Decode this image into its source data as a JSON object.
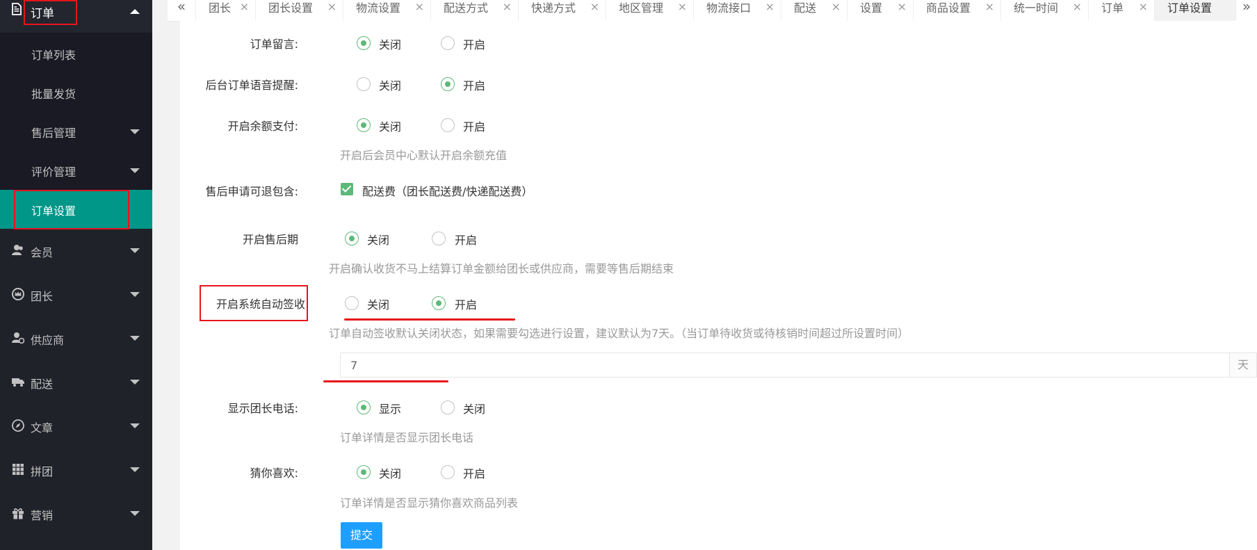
{
  "sidebar": {
    "top": {
      "label": "订单",
      "icon": "document-icon"
    },
    "sub_items": [
      {
        "label": "订单列表",
        "has_arrow": false,
        "active": false
      },
      {
        "label": "批量发货",
        "has_arrow": false,
        "active": false
      },
      {
        "label": "售后管理",
        "has_arrow": true,
        "active": false
      },
      {
        "label": "评价管理",
        "has_arrow": true,
        "active": false
      },
      {
        "label": "订单设置",
        "has_arrow": false,
        "active": true
      }
    ],
    "items": [
      {
        "label": "会员",
        "icon": "user-icon"
      },
      {
        "label": "团长",
        "icon": "crown-icon"
      },
      {
        "label": "供应商",
        "icon": "supplier-icon"
      },
      {
        "label": "配送",
        "icon": "truck-icon"
      },
      {
        "label": "文章",
        "icon": "compass-icon"
      },
      {
        "label": "拼团",
        "icon": "grid-icon"
      },
      {
        "label": "营销",
        "icon": "gift-icon"
      }
    ]
  },
  "tabs": {
    "prev": "«",
    "next": "»",
    "items": [
      {
        "label": "团长",
        "active": false
      },
      {
        "label": "团长设置",
        "active": false
      },
      {
        "label": "物流设置",
        "active": false
      },
      {
        "label": "配送方式",
        "active": false
      },
      {
        "label": "快递方式",
        "active": false
      },
      {
        "label": "地区管理",
        "active": false
      },
      {
        "label": "物流接口",
        "active": false
      },
      {
        "label": "配送",
        "active": false
      },
      {
        "label": "设置",
        "active": false
      },
      {
        "label": "商品设置",
        "active": false
      },
      {
        "label": "统一时间",
        "active": false
      },
      {
        "label": "订单",
        "active": false
      },
      {
        "label": "订单设置",
        "active": true
      }
    ],
    "close_glyph": "×"
  },
  "form": {
    "order_message": {
      "label": "订单留言:",
      "options": [
        "关闭",
        "开启"
      ],
      "selected": 0
    },
    "voice_alert": {
      "label": "后台订单语音提醒:",
      "options": [
        "关闭",
        "开启"
      ],
      "selected": 1
    },
    "balance_pay": {
      "label": "开启余额支付:",
      "options": [
        "关闭",
        "开启"
      ],
      "selected": 0,
      "hint": "开启后会员中心默认开启余额充值"
    },
    "aftersale_refund": {
      "label": "售后申请可退包含:",
      "checkbox_label": "配送费（团长配送费/快递配送费）",
      "checked": true
    },
    "aftersale_period": {
      "label": "开启售后期",
      "options": [
        "关闭",
        "开启"
      ],
      "selected": 0,
      "hint": "开启确认收货不马上结算订单金额给团长或供应商，需要等售后期结束"
    },
    "auto_sign": {
      "label": "开启系统自动签收",
      "options": [
        "关闭",
        "开启"
      ],
      "selected": 1,
      "hint": "订单自动签收默认关闭状态，如果需要勾选进行设置，建议默认为7天。（当订单待收货或待核销时间超过所设置时间）",
      "days_value": "7",
      "days_unit": "天"
    },
    "show_phone": {
      "label": "显示团长电话:",
      "options": [
        "显示",
        "关闭"
      ],
      "selected": 0,
      "hint": "订单详情是否显示团长电话"
    },
    "guess_like": {
      "label": "猜你喜欢:",
      "options": [
        "关闭",
        "开启"
      ],
      "selected": 0,
      "hint": "订单详情是否显示猜你喜欢商品列表"
    },
    "submit_label": "提交"
  },
  "colors": {
    "sidebar_bg": "#20222a",
    "active_item": "#009688",
    "radio_checked": "#5fb878",
    "annotation": "#e8141b",
    "submit_button": "#1e9fff"
  }
}
